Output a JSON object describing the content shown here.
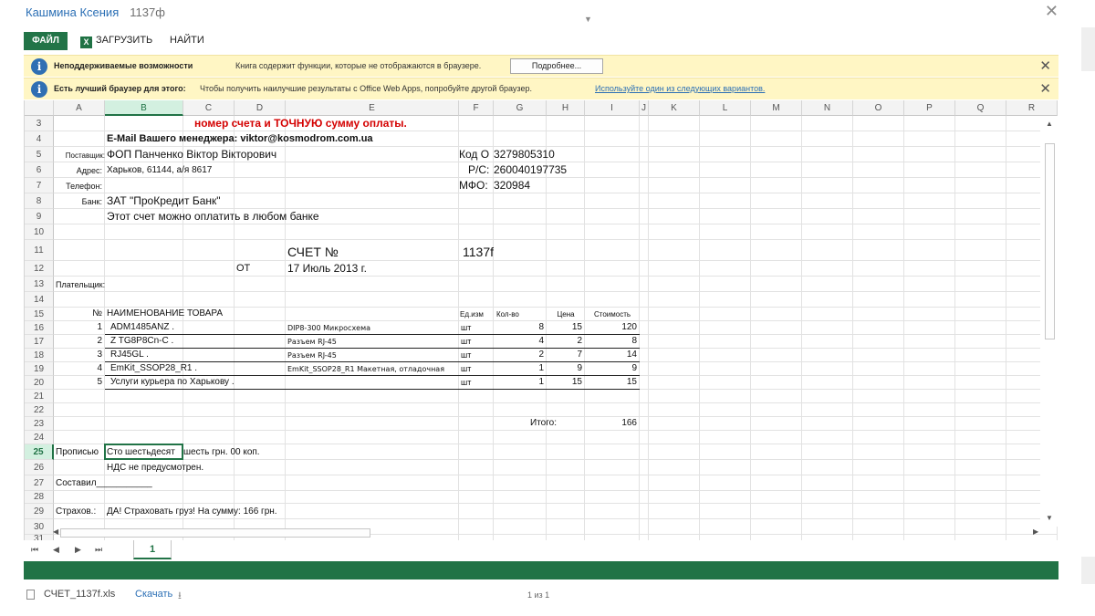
{
  "window": {
    "title": "Кашмина Ксения",
    "doc_number": "1137ф"
  },
  "ribbon": {
    "file": "ФАЙЛ",
    "download": "ЗАГРУЗИТЬ",
    "download_icon": "X",
    "find": "НАЙТИ"
  },
  "notifications": [
    {
      "label": "Неподдерживаемые возможности",
      "text": "Книга содержит функции, которые не отображаются в браузере.",
      "button": "Подробнее..."
    },
    {
      "label": "Есть лучший браузер для этого:",
      "text": "Чтобы получить наилучшие результаты с Office Web Apps, попробуйте другой браузер.",
      "link": "Используйте один из следующих вариантов."
    }
  ],
  "columns": [
    "A",
    "B",
    "C",
    "D",
    "E",
    "F",
    "G",
    "H",
    "I",
    "J",
    "K",
    "L",
    "M",
    "N",
    "O",
    "P",
    "Q",
    "R"
  ],
  "selected_column": "B",
  "rows": [
    "3",
    "4",
    "5",
    "6",
    "7",
    "8",
    "9",
    "10",
    "11",
    "12",
    "13",
    "14",
    "15",
    "16",
    "17",
    "18",
    "19",
    "20",
    "21",
    "22",
    "23",
    "24",
    "25",
    "26",
    "27",
    "28",
    "29",
    "30",
    "31"
  ],
  "selected_row": "25",
  "sheet": {
    "r3": "номер счета и ТОЧНУЮ сумму оплаты.",
    "r4": "E-Mail Вашего менеджера: viktor@kosmodrom.com.ua",
    "supplier_label": "Поставщик:",
    "supplier": "ФОП Панченко Віктор Вікторович",
    "code_label": "Код О",
    "code": "3279805310",
    "address_label": "Адрес:",
    "address": "Харьков, 61144, а/я 8617",
    "rs_label": "Р/С:",
    "rs": "260040197735",
    "phone_label": "Телефон:",
    "mfo_label": "МФО:",
    "mfo": "320984",
    "bank_label": "Банк:",
    "bank": "ЗАТ \"ПроКредит Банк\"",
    "note": "Этот счет можно оплатить в любом банке",
    "invoice_title": "СЧЕТ №",
    "invoice_number": "1137f",
    "from_label": "ОТ",
    "date": "17 Июль 2013 г.",
    "payer_label": "Плательщик:",
    "table_header": {
      "num": "№",
      "name": "НАИМЕНОВАНИЕ ТОВАРА",
      "unit": "Ед.изм",
      "qty": "Кол-во",
      "price": "Цена",
      "cost": "Стоимость"
    },
    "items": [
      {
        "num": "1",
        "name": "ADM1485ANZ .",
        "desc": "DIP8-300 Микросхема",
        "unit": "шт",
        "qty": "8",
        "price": "15",
        "cost": "120"
      },
      {
        "num": "2",
        "name": "Z TG8P8Cn-C .",
        "desc": "Разъем RJ-45",
        "unit": "шт",
        "qty": "4",
        "price": "2",
        "cost": "8"
      },
      {
        "num": "3",
        "name": "RJ45GL .",
        "desc": "Разъем RJ-45",
        "unit": "шт",
        "qty": "2",
        "price": "7",
        "cost": "14"
      },
      {
        "num": "4",
        "name": "EmKit_SSOP28_R1 .",
        "desc": "EmKit_SSOP28_R1 Макетная, отладочная",
        "unit": "шт",
        "qty": "1",
        "price": "9",
        "cost": "9"
      },
      {
        "num": "5",
        "name": "Услуги курьера по Харькову .",
        "desc": "",
        "unit": "шт",
        "qty": "1",
        "price": "15",
        "cost": "15"
      }
    ],
    "total_label": "Итого:",
    "total": "166",
    "words_label": "Прописью",
    "words_part1": "Сто шестьдесят",
    "words_part2": "шесть грн. 00 коп.",
    "vat": "НДС не предусмотрен.",
    "author": "Составил___________",
    "insurance_label": "Страхов.:",
    "insurance": "ДА! Страховать груз! На сумму:  166 грн."
  },
  "sheet_tab": "1",
  "download_bar": {
    "filename": "СЧЕТ_1137f.xls",
    "download": "Скачать",
    "pages": "1 из 1"
  }
}
